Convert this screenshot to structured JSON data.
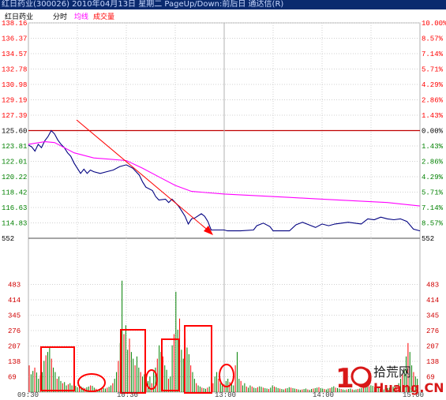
{
  "window": {
    "title": "红日药业(300026)  2010年04月13日 星期二  PageUp/Down:前后日  通达信(R)"
  },
  "legend": {
    "stock_name": "红日药业",
    "mode": "分时",
    "avg_line": "均线",
    "volume": "成交量",
    "colors": {
      "stock_name": "#000000",
      "mode": "#000000",
      "avg_line": "#ff00ff",
      "volume_a": "#ff0000",
      "volume_b": "#008000"
    }
  },
  "price_axis": {
    "labels": [
      "138.16",
      "136.37",
      "134.57",
      "132.78",
      "130.98",
      "129.19",
      "127.39",
      "125.60",
      "123.81",
      "122.01",
      "120.22",
      "118.42",
      "116.63",
      "114.83",
      "552"
    ],
    "label_colors": [
      "#ff0000",
      "#ff0000",
      "#ff0000",
      "#ff0000",
      "#ff0000",
      "#ff0000",
      "#ff0000",
      "#000000",
      "#008000",
      "#008000",
      "#008000",
      "#008000",
      "#008000",
      "#008000",
      "#000000"
    ]
  },
  "pct_axis": {
    "labels": [
      "10.00%",
      "8.57%",
      "7.14%",
      "5.71%",
      "4.29%",
      "2.86%",
      "1.43%",
      "0.00%",
      "1.43%",
      "2.86%",
      "4.29%",
      "5.71%",
      "7.14%",
      "8.57%",
      "552"
    ],
    "label_colors": [
      "#ff0000",
      "#ff0000",
      "#ff0000",
      "#ff0000",
      "#ff0000",
      "#ff0000",
      "#ff0000",
      "#000000",
      "#008000",
      "#008000",
      "#008000",
      "#008000",
      "#008000",
      "#008000",
      "#000000"
    ]
  },
  "volume_axis": {
    "labels": [
      "483",
      "414",
      "345",
      "276",
      "207",
      "138",
      "69"
    ]
  },
  "time_axis": {
    "labels": [
      "09:30",
      "10:30",
      "13:00",
      "14:00",
      "15:00"
    ]
  },
  "chart_data": {
    "type": "line",
    "prev_close": 125.6,
    "ylim": [
      114.83,
      138.16
    ],
    "volume_ylim": [
      0,
      552
    ],
    "session_minutes": 240,
    "series": [
      {
        "name": "分时",
        "color": "#000080",
        "points": [
          [
            0,
            123.9
          ],
          [
            2,
            123.7
          ],
          [
            4,
            123.2
          ],
          [
            6,
            124.0
          ],
          [
            8,
            123.6
          ],
          [
            10,
            124.4
          ],
          [
            12,
            124.9
          ],
          [
            14,
            125.6
          ],
          [
            16,
            125.2
          ],
          [
            18,
            124.5
          ],
          [
            20,
            124.0
          ],
          [
            22,
            123.6
          ],
          [
            24,
            123.0
          ],
          [
            26,
            122.6
          ],
          [
            28,
            121.8
          ],
          [
            30,
            121.2
          ],
          [
            32,
            120.6
          ],
          [
            34,
            121.1
          ],
          [
            36,
            120.6
          ],
          [
            38,
            121.0
          ],
          [
            40,
            120.8
          ],
          [
            44,
            120.6
          ],
          [
            48,
            120.8
          ],
          [
            52,
            121.0
          ],
          [
            56,
            121.4
          ],
          [
            60,
            121.6
          ],
          [
            64,
            121.2
          ],
          [
            68,
            120.4
          ],
          [
            70,
            119.6
          ],
          [
            72,
            119.0
          ],
          [
            76,
            118.6
          ],
          [
            78,
            117.9
          ],
          [
            80,
            117.5
          ],
          [
            84,
            117.6
          ],
          [
            86,
            117.2
          ],
          [
            88,
            117.6
          ],
          [
            92,
            116.8
          ],
          [
            94,
            116.2
          ],
          [
            96,
            115.6
          ],
          [
            98,
            114.7
          ],
          [
            100,
            115.3
          ],
          [
            102,
            115.4
          ],
          [
            106,
            115.9
          ],
          [
            108,
            115.6
          ],
          [
            110,
            115.0
          ],
          [
            112,
            114.0
          ],
          [
            116,
            114.0
          ],
          [
            120,
            114.0
          ],
          [
            122,
            113.9
          ],
          [
            130,
            113.9
          ],
          [
            138,
            114.0
          ],
          [
            140,
            114.5
          ],
          [
            144,
            114.8
          ],
          [
            148,
            114.4
          ],
          [
            150,
            113.9
          ],
          [
            160,
            113.9
          ],
          [
            164,
            114.6
          ],
          [
            168,
            114.9
          ],
          [
            172,
            114.6
          ],
          [
            176,
            114.3
          ],
          [
            180,
            114.7
          ],
          [
            184,
            114.5
          ],
          [
            188,
            114.7
          ],
          [
            192,
            114.8
          ],
          [
            196,
            114.9
          ],
          [
            200,
            114.8
          ],
          [
            204,
            114.7
          ],
          [
            208,
            115.3
          ],
          [
            212,
            115.2
          ],
          [
            216,
            115.5
          ],
          [
            220,
            115.3
          ],
          [
            224,
            115.2
          ],
          [
            228,
            115.3
          ],
          [
            232,
            115.0
          ],
          [
            236,
            114.1
          ],
          [
            240,
            113.9
          ]
        ]
      },
      {
        "name": "均线",
        "color": "#ff00ff",
        "points": [
          [
            0,
            124.0
          ],
          [
            10,
            124.3
          ],
          [
            16,
            124.2
          ],
          [
            22,
            123.6
          ],
          [
            28,
            123.0
          ],
          [
            40,
            122.4
          ],
          [
            60,
            122.1
          ],
          [
            70,
            121.2
          ],
          [
            80,
            120.2
          ],
          [
            90,
            119.2
          ],
          [
            100,
            118.5
          ],
          [
            120,
            118.2
          ],
          [
            140,
            118.0
          ],
          [
            160,
            117.8
          ],
          [
            180,
            117.6
          ],
          [
            200,
            117.4
          ],
          [
            220,
            117.2
          ],
          [
            240,
            116.8
          ]
        ]
      }
    ],
    "volume": [
      120,
      80,
      95,
      110,
      88,
      60,
      75,
      90,
      140,
      165,
      180,
      200,
      150,
      110,
      90,
      60,
      70,
      50,
      40,
      45,
      30,
      35,
      40,
      30,
      25,
      28,
      22,
      30,
      25,
      20,
      18,
      22,
      25,
      30,
      28,
      20,
      15,
      10,
      12,
      14,
      18,
      16,
      20,
      24,
      30,
      40,
      60,
      90,
      140,
      220,
      500,
      260,
      300,
      190,
      240,
      180,
      150,
      120,
      160,
      110,
      90,
      70,
      80,
      60,
      50,
      70,
      40,
      90,
      110,
      150,
      210,
      180,
      160,
      120,
      100,
      60,
      70,
      210,
      260,
      450,
      280,
      330,
      190,
      150,
      240,
      200,
      170,
      120,
      90,
      60,
      40,
      30,
      25,
      20,
      18,
      15,
      20,
      25,
      30,
      40,
      70,
      90,
      60,
      40,
      30,
      35,
      50,
      60,
      45,
      40,
      30,
      120,
      180,
      60,
      50,
      30,
      40,
      25,
      20,
      30,
      25,
      20,
      18,
      22,
      26,
      24,
      20,
      18,
      16,
      14,
      20,
      30,
      25,
      22,
      18,
      16,
      14,
      12,
      16,
      18,
      22,
      20,
      18,
      16,
      14,
      12,
      10,
      12,
      14,
      16,
      12,
      10,
      14,
      16,
      18,
      20,
      22,
      18,
      16,
      14,
      12,
      16,
      18,
      22,
      26,
      20,
      18,
      16,
      14,
      12,
      10,
      12,
      14,
      16,
      12,
      10,
      12,
      14,
      16,
      18,
      20,
      22,
      24,
      26,
      30,
      28,
      24,
      20,
      18,
      16,
      14,
      12,
      16,
      18,
      20,
      22,
      24,
      26,
      30,
      40,
      60,
      80,
      100,
      160,
      220,
      180,
      120,
      90,
      70,
      60
    ]
  },
  "annotation_arrow": {
    "color": "#ff0000"
  },
  "highlight_color": "#ff0000",
  "watermark": {
    "number": "10",
    "cn_text": "拾荒网",
    "url_text": "Huang.CN"
  }
}
